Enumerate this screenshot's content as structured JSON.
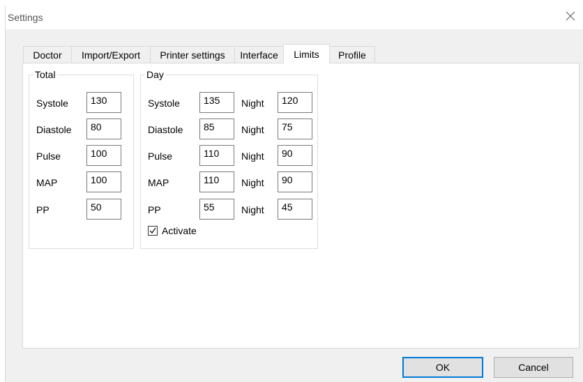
{
  "window": {
    "title": "Settings"
  },
  "tabs": [
    "Doctor",
    "Import/Export",
    "Printer settings",
    "Interface",
    "Limits",
    "Profile"
  ],
  "active_tab": "Limits",
  "total_group": {
    "legend": "Total",
    "rows": [
      {
        "label": "Systole",
        "value": "130"
      },
      {
        "label": "Diastole",
        "value": "80"
      },
      {
        "label": "Pulse",
        "value": "100"
      },
      {
        "label": "MAP",
        "value": "100"
      },
      {
        "label": "PP",
        "value": "50"
      }
    ]
  },
  "day_group": {
    "legend": "Day",
    "night_label": "Night",
    "rows": [
      {
        "label": "Systole",
        "day": "135",
        "night": "120"
      },
      {
        "label": "Diastole",
        "day": "85",
        "night": "75"
      },
      {
        "label": "Pulse",
        "day": "110",
        "night": "90"
      },
      {
        "label": "MAP",
        "day": "110",
        "night": "90"
      },
      {
        "label": "PP",
        "day": "55",
        "night": "45"
      }
    ],
    "activate_label": "Activate",
    "activate_checked": true
  },
  "buttons": {
    "ok": "OK",
    "cancel": "Cancel"
  },
  "icons": {
    "close": "close-icon",
    "checkbox": "checkmark-icon"
  },
  "colors": {
    "accent": "#0078d7"
  }
}
